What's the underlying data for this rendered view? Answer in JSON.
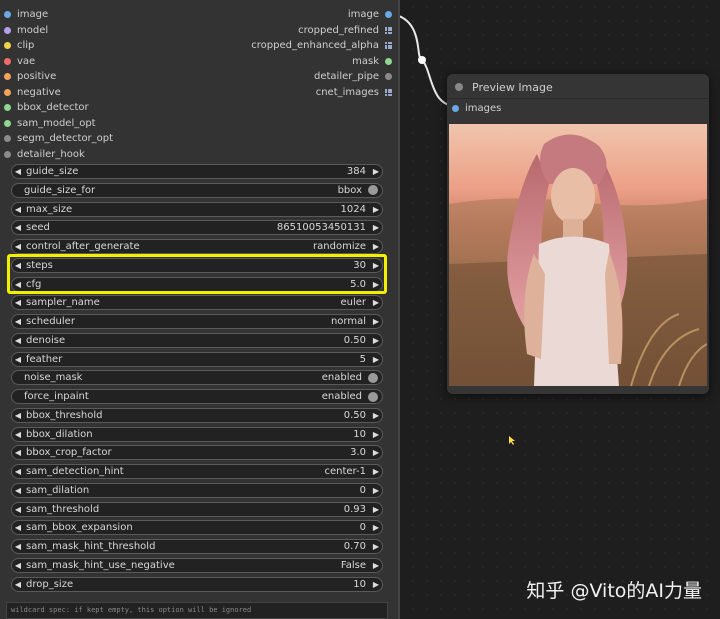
{
  "left_node": {
    "inputs": [
      {
        "label": "image",
        "color": "#6aa8e6"
      },
      {
        "label": "model",
        "color": "#b59ee8"
      },
      {
        "label": "clip",
        "color": "#f2d24a"
      },
      {
        "label": "vae",
        "color": "#f26b6b"
      },
      {
        "label": "positive",
        "color": "#f5a25a"
      },
      {
        "label": "negative",
        "color": "#f5a25a"
      },
      {
        "label": "bbox_detector",
        "color": "#8fd68f"
      },
      {
        "label": "sam_model_opt",
        "color": "#8fd68f"
      },
      {
        "label": "segm_detector_opt",
        "color": "#8a8a8a"
      },
      {
        "label": "detailer_hook",
        "color": "#8a8a8a"
      }
    ],
    "outputs": [
      {
        "label": "image",
        "type": "dot",
        "color": "#6aa8e6"
      },
      {
        "label": "cropped_refined",
        "type": "grid",
        "color": "#8fb0d8"
      },
      {
        "label": "cropped_enhanced_alpha",
        "type": "grid",
        "color": "#8fb0d8"
      },
      {
        "label": "mask",
        "type": "dot",
        "color": "#8fd68f"
      },
      {
        "label": "detailer_pipe",
        "type": "dot",
        "color": "#8a8a8a"
      },
      {
        "label": "cnet_images",
        "type": "grid",
        "color": "#8fb0d8"
      }
    ],
    "widgets": [
      {
        "name": "guide_size",
        "value": "384",
        "kind": "number"
      },
      {
        "name": "guide_size_for",
        "value": "bbox",
        "kind": "toggle"
      },
      {
        "name": "max_size",
        "value": "1024",
        "kind": "number"
      },
      {
        "name": "seed",
        "value": "86510053450131",
        "kind": "number"
      },
      {
        "name": "control_after_generate",
        "value": "randomize",
        "kind": "number"
      },
      {
        "name": "steps",
        "value": "30",
        "kind": "number"
      },
      {
        "name": "cfg",
        "value": "5.0",
        "kind": "number"
      },
      {
        "name": "sampler_name",
        "value": "euler",
        "kind": "number"
      },
      {
        "name": "scheduler",
        "value": "normal",
        "kind": "number"
      },
      {
        "name": "denoise",
        "value": "0.50",
        "kind": "number"
      },
      {
        "name": "feather",
        "value": "5",
        "kind": "number"
      },
      {
        "name": "noise_mask",
        "value": "enabled",
        "kind": "toggle"
      },
      {
        "name": "force_inpaint",
        "value": "enabled",
        "kind": "toggle"
      },
      {
        "name": "bbox_threshold",
        "value": "0.50",
        "kind": "number"
      },
      {
        "name": "bbox_dilation",
        "value": "10",
        "kind": "number"
      },
      {
        "name": "bbox_crop_factor",
        "value": "3.0",
        "kind": "number"
      },
      {
        "name": "sam_detection_hint",
        "value": "center-1",
        "kind": "number"
      },
      {
        "name": "sam_dilation",
        "value": "0",
        "kind": "number"
      },
      {
        "name": "sam_threshold",
        "value": "0.93",
        "kind": "number"
      },
      {
        "name": "sam_bbox_expansion",
        "value": "0",
        "kind": "number"
      },
      {
        "name": "sam_mask_hint_threshold",
        "value": "0.70",
        "kind": "number"
      },
      {
        "name": "sam_mask_hint_use_negative",
        "value": "False",
        "kind": "number"
      },
      {
        "name": "drop_size",
        "value": "10",
        "kind": "number"
      }
    ],
    "wildcard_placeholder": "wildcard spec: if kept empty, this option will be ignored"
  },
  "preview_node": {
    "title": "Preview Image",
    "input_label": "images",
    "input_color": "#6aa8e6"
  },
  "watermark": "知乎 @Vito的AI力量",
  "colors": {
    "highlight": "#f0f000",
    "node_bg": "#333333",
    "canvas_bg": "#1e1e1e"
  }
}
